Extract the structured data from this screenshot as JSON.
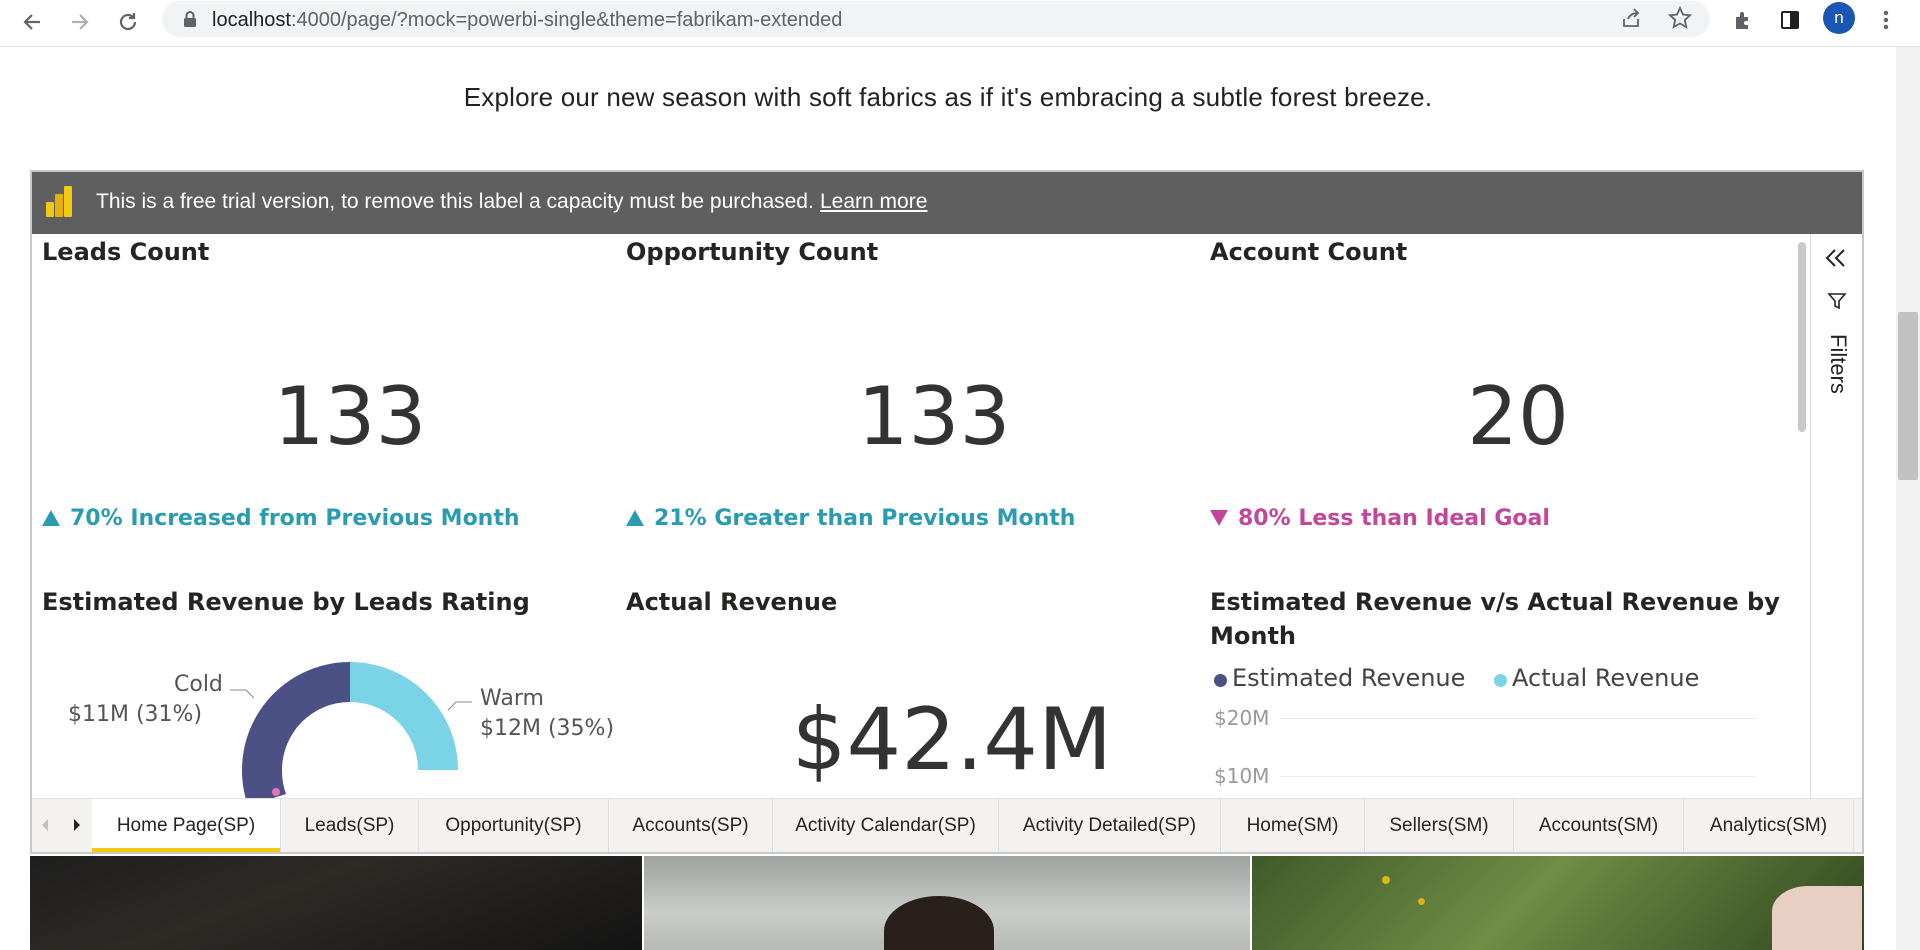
{
  "browser": {
    "url_host": "localhost",
    "url_rest": ":4000/page/?mock=powerbi-single&theme=fabrikam-extended",
    "avatar_letter": "n"
  },
  "tagline": "Explore our new season with soft fabrics as if it's embracing a subtle forest breeze.",
  "report": {
    "trial_message": "This is a free trial version, to remove this label a capacity must be purchased.",
    "learn_more": "Learn more",
    "filters_label": "Filters",
    "cards": [
      {
        "title": "Leads Count",
        "value": "133",
        "trend": "70% Increased from Previous Month",
        "direction": "up"
      },
      {
        "title": "Opportunity Count",
        "value": "133",
        "trend": "21% Greater than Previous Month",
        "direction": "up"
      },
      {
        "title": "Account Count",
        "value": "20",
        "trend": "80% Less than Ideal Goal",
        "direction": "down"
      }
    ],
    "donut": {
      "title": "Estimated Revenue by Leads Rating",
      "cold_label": "Cold",
      "cold_value": "$11M (31%)",
      "warm_label": "Warm",
      "warm_value": "$12M (35%)"
    },
    "actual_revenue": {
      "title": "Actual Revenue",
      "value": "$42.4M"
    },
    "combo": {
      "title_line1": "Estimated Revenue v/s Actual Revenue by",
      "title_line2": "Month",
      "legend": [
        "Estimated Revenue",
        "Actual Revenue"
      ],
      "y_ticks": [
        "$20M",
        "$10M"
      ]
    },
    "tabs": [
      "Home Page(SP)",
      "Leads(SP)",
      "Opportunity(SP)",
      "Accounts(SP)",
      "Activity Calendar(SP)",
      "Activity Detailed(SP)",
      "Home(SM)",
      "Sellers(SM)",
      "Accounts(SM)",
      "Analytics(SM)"
    ],
    "active_tab": "Home Page(SP)"
  },
  "colors": {
    "trend_up": "#2a9cb2",
    "trend_down": "#c2479a",
    "series_estimated": "#4b5185",
    "series_actual": "#7bd3e8",
    "active_tab_underline": "#f2c811",
    "trial_bar": "#5f5f5f"
  },
  "chart_data": {
    "type": "pie",
    "title": "Estimated Revenue by Leads Rating",
    "categories": [
      "Cold",
      "Warm"
    ],
    "values": [
      11,
      12
    ],
    "percent_labels": [
      "31%",
      "35%"
    ],
    "unit": "$M"
  }
}
